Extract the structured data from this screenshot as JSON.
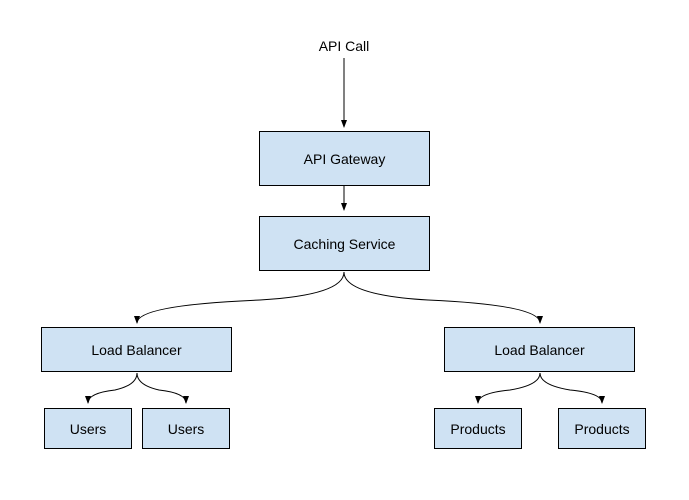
{
  "diagram": {
    "title": "API Call",
    "apiGateway": "API Gateway",
    "cachingService": "Caching Service",
    "loadBalancerLeft": "Load Balancer",
    "loadBalancerRight": "Load Balancer",
    "usersLeft": "Users",
    "usersRight": "Users",
    "productsLeft": "Products",
    "productsRight": "Products"
  }
}
